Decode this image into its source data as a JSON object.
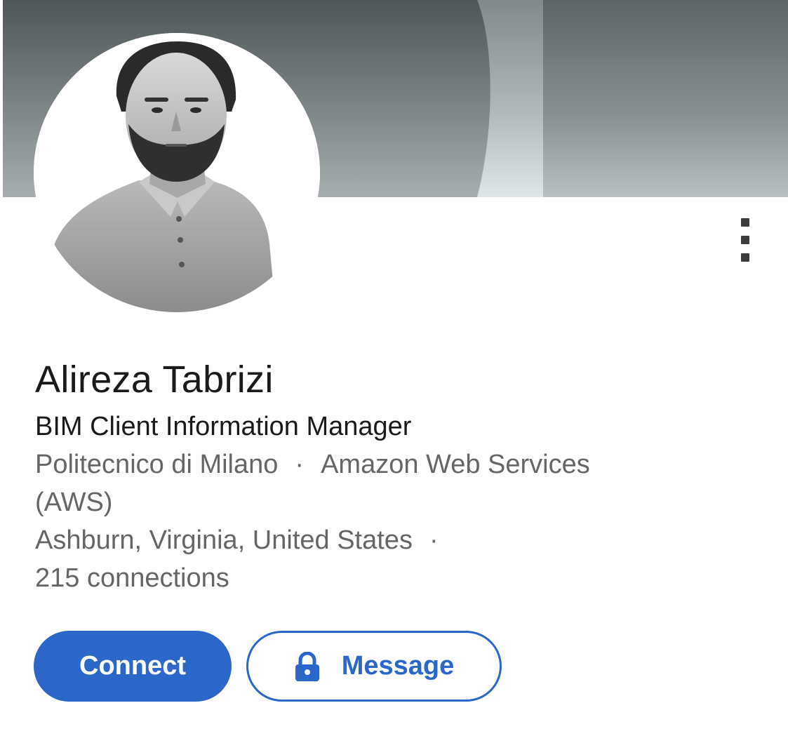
{
  "profile": {
    "name": "Alireza Tabrizi",
    "headline": "BIM Client Information Manager",
    "education": "Politecnico di Milano",
    "separator": "·",
    "company_line1": "Amazon Web Services",
    "company_line2": "(AWS)",
    "location": "Ashburn, Virginia, United States",
    "connections": "215 connections"
  },
  "actions": {
    "connect_label": "Connect",
    "message_label": "Message",
    "more_icon": "vertical-ellipsis-icon",
    "message_icon": "lock-icon"
  },
  "colors": {
    "accent": "#2a67c8",
    "primary_text": "#1a1a1a",
    "secondary_text": "#666666"
  }
}
